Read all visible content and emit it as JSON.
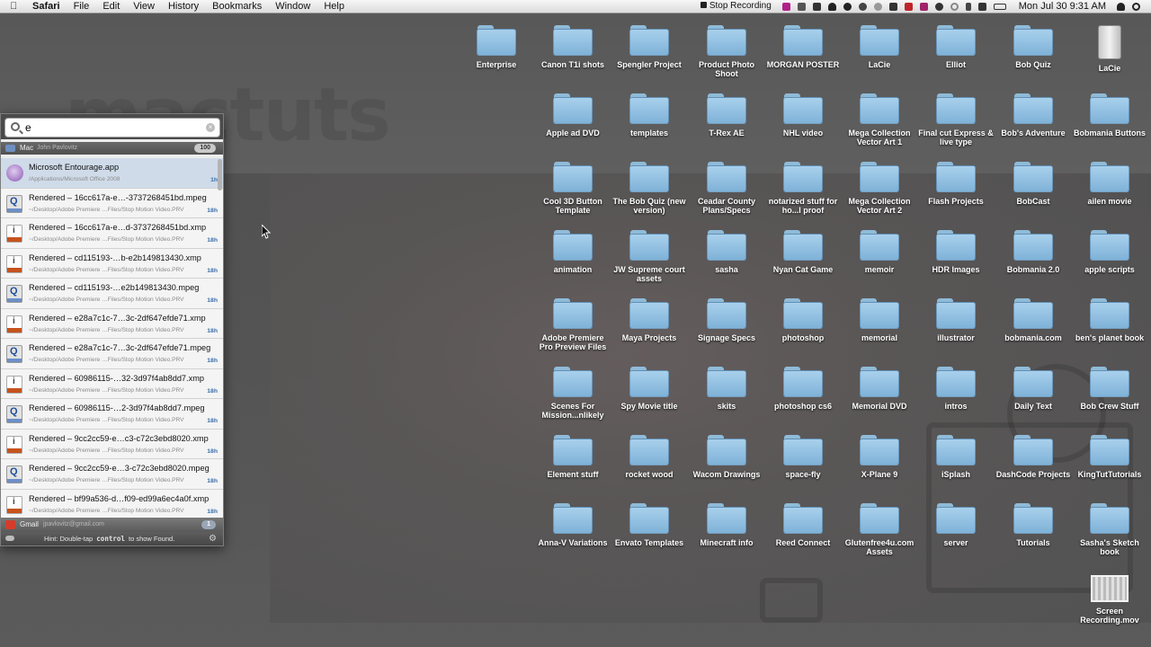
{
  "menubar": {
    "app": "Safari",
    "menus": [
      "File",
      "Edit",
      "View",
      "History",
      "Bookmarks",
      "Window",
      "Help"
    ],
    "stop_recording": "Stop Recording",
    "clock": "Mon Jul 30  9:31 AM"
  },
  "desktop": {
    "watermark": "mactuts",
    "icons": [
      {
        "label": "Enterprise",
        "kind": "folder"
      },
      {
        "label": "Canon T1i shots",
        "kind": "folder"
      },
      {
        "label": "Spengler Project",
        "kind": "folder"
      },
      {
        "label": "Product Photo Shoot",
        "kind": "folder"
      },
      {
        "label": "MORGAN POSTER",
        "kind": "folder"
      },
      {
        "label": "LaCie",
        "kind": "folder"
      },
      {
        "label": "Elliot",
        "kind": "folder"
      },
      {
        "label": "Bob Quiz",
        "kind": "folder"
      },
      {
        "label": "LaCie",
        "kind": "drive"
      },
      {
        "label": "Apple ad DVD",
        "kind": "folder"
      },
      {
        "label": "templates",
        "kind": "folder"
      },
      {
        "label": "T-Rex AE",
        "kind": "folder"
      },
      {
        "label": "NHL video",
        "kind": "folder"
      },
      {
        "label": "Mega Collection Vector Art 1",
        "kind": "folder"
      },
      {
        "label": "Final cut Express & live type",
        "kind": "folder"
      },
      {
        "label": "Bob's Adventure",
        "kind": "folder"
      },
      {
        "label": "Bobmania Buttons",
        "kind": "folder"
      },
      {
        "label": "Cool 3D Button Template",
        "kind": "folder"
      },
      {
        "label": "The Bob Quiz (new version)",
        "kind": "folder"
      },
      {
        "label": "Ceadar County Plans/Specs",
        "kind": "folder"
      },
      {
        "label": "notarized stuff for ho...l proof",
        "kind": "folder"
      },
      {
        "label": "Mega Collection Vector Art 2",
        "kind": "folder"
      },
      {
        "label": "Flash Projects",
        "kind": "folder"
      },
      {
        "label": "BobCast",
        "kind": "folder"
      },
      {
        "label": "ailen movie",
        "kind": "folder"
      },
      {
        "label": "animation",
        "kind": "folder"
      },
      {
        "label": "JW Supreme court assets",
        "kind": "folder"
      },
      {
        "label": "sasha",
        "kind": "folder"
      },
      {
        "label": "Nyan Cat Game",
        "kind": "folder"
      },
      {
        "label": "memoir",
        "kind": "folder"
      },
      {
        "label": "HDR Images",
        "kind": "folder"
      },
      {
        "label": "Bobmania 2.0",
        "kind": "folder"
      },
      {
        "label": "apple scripts",
        "kind": "folder"
      },
      {
        "label": "Adobe Premiere Pro Preview Files",
        "kind": "folder"
      },
      {
        "label": "Maya Projects",
        "kind": "folder"
      },
      {
        "label": "Signage Specs",
        "kind": "folder"
      },
      {
        "label": "photoshop",
        "kind": "folder"
      },
      {
        "label": "memorial",
        "kind": "folder"
      },
      {
        "label": "illustrator",
        "kind": "folder"
      },
      {
        "label": "bobmania.com",
        "kind": "folder"
      },
      {
        "label": "ben's planet book",
        "kind": "folder"
      },
      {
        "label": "Scenes For Mission...nlikely",
        "kind": "folder"
      },
      {
        "label": "Spy Movie title",
        "kind": "folder"
      },
      {
        "label": "skits",
        "kind": "folder"
      },
      {
        "label": "photoshop cs6",
        "kind": "folder"
      },
      {
        "label": "Memorial DVD",
        "kind": "folder"
      },
      {
        "label": "intros",
        "kind": "folder"
      },
      {
        "label": "Daily Text",
        "kind": "folder"
      },
      {
        "label": "Bob Crew Stuff",
        "kind": "folder"
      },
      {
        "label": "Element stuff",
        "kind": "folder"
      },
      {
        "label": "rocket wood",
        "kind": "folder"
      },
      {
        "label": "Wacom Drawings",
        "kind": "folder"
      },
      {
        "label": "space-fly",
        "kind": "folder"
      },
      {
        "label": "X-Plane 9",
        "kind": "folder"
      },
      {
        "label": "iSplash",
        "kind": "folder"
      },
      {
        "label": "DashCode Projects",
        "kind": "folder"
      },
      {
        "label": "KingTutTutorials",
        "kind": "folder"
      },
      {
        "label": "Anna-V Variations",
        "kind": "folder"
      },
      {
        "label": "Envato Templates",
        "kind": "folder"
      },
      {
        "label": "Minecraft info",
        "kind": "folder"
      },
      {
        "label": "Reed Connect",
        "kind": "folder"
      },
      {
        "label": "Glutenfree4u.com Assets",
        "kind": "folder"
      },
      {
        "label": "server",
        "kind": "folder"
      },
      {
        "label": "Tutorials",
        "kind": "folder"
      },
      {
        "label": "Sasha's Sketch book",
        "kind": "folder"
      },
      {
        "label": "Screen Recording.mov",
        "kind": "movie"
      }
    ]
  },
  "finder": {
    "query": "e",
    "mac_section": {
      "name": "Mac",
      "user": "John Pavlovitz",
      "count": "100"
    },
    "results": [
      {
        "title": "Microsoft Entourage.app",
        "path": "/Applications/Microsoft Office 2008",
        "age": "1h",
        "icon": "app",
        "selected": true
      },
      {
        "title": "Rendered – 16cc617a-e…-3737268451bd.mpeg",
        "path": "~/Desktop/Adobe Premiere …Files/Stop Motion Video.PRV",
        "age": "18h",
        "icon": "mpeg"
      },
      {
        "title": "Rendered – 16cc617a-e…d-3737268451bd.xmp",
        "path": "~/Desktop/Adobe Premiere …Files/Stop Motion Video.PRV",
        "age": "18h",
        "icon": "xmp"
      },
      {
        "title": "Rendered – cd115193-…b-e2b149813430.xmp",
        "path": "~/Desktop/Adobe Premiere …Files/Stop Motion Video.PRV",
        "age": "18h",
        "icon": "xmp"
      },
      {
        "title": "Rendered – cd115193-…e2b149813430.mpeg",
        "path": "~/Desktop/Adobe Premiere …Files/Stop Motion Video.PRV",
        "age": "18h",
        "icon": "mpeg"
      },
      {
        "title": "Rendered – e28a7c1c-7…3c-2df647efde71.xmp",
        "path": "~/Desktop/Adobe Premiere …Files/Stop Motion Video.PRV",
        "age": "18h",
        "icon": "xmp"
      },
      {
        "title": "Rendered – e28a7c1c-7…3c-2df647efde71.mpeg",
        "path": "~/Desktop/Adobe Premiere …Files/Stop Motion Video.PRV",
        "age": "18h",
        "icon": "mpeg"
      },
      {
        "title": "Rendered – 60986115-…32-3d97f4ab8dd7.xmp",
        "path": "~/Desktop/Adobe Premiere …Files/Stop Motion Video.PRV",
        "age": "18h",
        "icon": "xmp"
      },
      {
        "title": "Rendered – 60986115-…2-3d97f4ab8dd7.mpeg",
        "path": "~/Desktop/Adobe Premiere …Files/Stop Motion Video.PRV",
        "age": "18h",
        "icon": "mpeg"
      },
      {
        "title": "Rendered – 9cc2cc59-e…c3-c72c3ebd8020.xmp",
        "path": "~/Desktop/Adobe Premiere …Files/Stop Motion Video.PRV",
        "age": "18h",
        "icon": "xmp"
      },
      {
        "title": "Rendered – 9cc2cc59-e…3-c72c3ebd8020.mpeg",
        "path": "~/Desktop/Adobe Premiere …Files/Stop Motion Video.PRV",
        "age": "18h",
        "icon": "mpeg"
      },
      {
        "title": "Rendered – bf99a536-d…f09-ed99a6ec4a0f.xmp",
        "path": "~/Desktop/Adobe Premiere …Files/Stop Motion Video.PRV",
        "age": "18h",
        "icon": "xmp"
      }
    ],
    "gmail_section": {
      "name": "Gmail",
      "user": "jpavlovitz@gmail.com",
      "count": "1"
    },
    "footer": {
      "hint_prefix": "Hint:  Double-tap",
      "hint_key": "control",
      "hint_suffix": "to show Found."
    }
  }
}
